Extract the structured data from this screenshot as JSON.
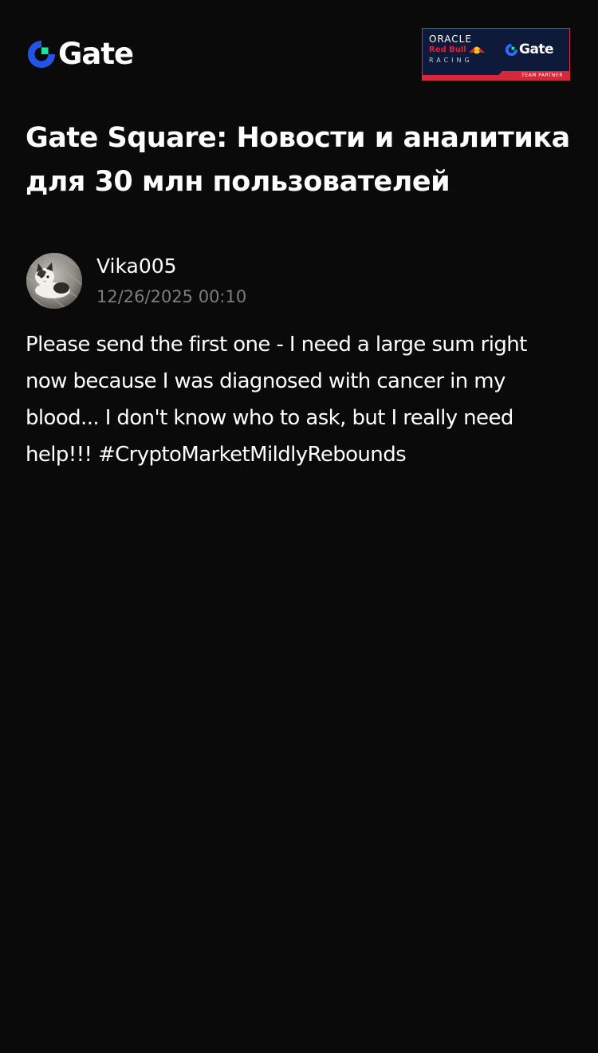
{
  "header": {
    "logo_text": "Gate",
    "logo_icon": "gate-logo-icon",
    "partner_badge": {
      "line1": "ORACLE",
      "line2": "Red Bull",
      "line3": "RACING",
      "brand": "Gate",
      "caption": "TEAM PARTNER"
    }
  },
  "page": {
    "title": "Gate Square: Новости и аналитика для 30 млн пользователей"
  },
  "post": {
    "author": "Vika005",
    "avatar_icon": "cat-avatar",
    "timestamp": "12/26/2025 00:10",
    "text": "Please send the first one - I need a large sum right now because I was diagnosed with cancer in my blood... I don't know who to ask, but I really need help!!! ",
    "hashtag": "#CryptoMarketMildlyRebounds"
  },
  "colors": {
    "background": "#0a0a0a",
    "text": "#ffffff",
    "muted": "#7d7d7d",
    "brand_blue": "#2354e6",
    "brand_green": "#17e6a1",
    "partner_navy": "#0d1a3a",
    "partner_red": "#d6283a"
  }
}
